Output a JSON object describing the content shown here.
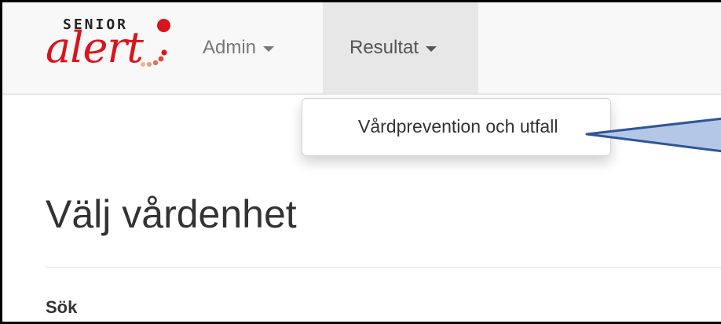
{
  "brand": {
    "logo_top": "SENIOR",
    "logo_main": "alert"
  },
  "nav": {
    "items": [
      {
        "label": "Admin"
      },
      {
        "label": "Resultat"
      }
    ]
  },
  "dropdown": {
    "items": [
      {
        "label": "Vårdprevention och utfall"
      }
    ]
  },
  "main": {
    "title": "Välj vårdenhet",
    "search_label": "Sök"
  },
  "colors": {
    "brand_red": "#d9141c",
    "navbar_bg": "#f8f8f8",
    "active_nav_bg": "#e7e7e7",
    "callout_fill": "#b4c7e7",
    "callout_stroke": "#2f5597"
  }
}
